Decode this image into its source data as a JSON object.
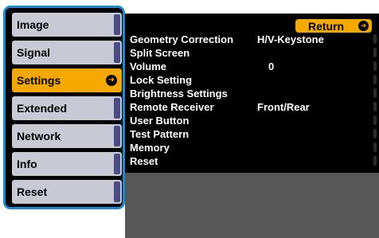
{
  "menu": {
    "items": [
      {
        "label": "Image",
        "selected": false
      },
      {
        "label": "Signal",
        "selected": false
      },
      {
        "label": "Settings",
        "selected": true
      },
      {
        "label": "Extended",
        "selected": false
      },
      {
        "label": "Network",
        "selected": false
      },
      {
        "label": "Info",
        "selected": false
      },
      {
        "label": "Reset",
        "selected": false
      }
    ],
    "enter_icon": "enter-icon"
  },
  "return_button": {
    "label": "Return",
    "icon": "enter-icon"
  },
  "settings": [
    {
      "name": "Geometry Correction",
      "value": "H/V-Keystone"
    },
    {
      "name": "Split Screen",
      "value": ""
    },
    {
      "name": "Volume",
      "value": "0"
    },
    {
      "name": "Lock Setting",
      "value": ""
    },
    {
      "name": "Brightness Settings",
      "value": ""
    },
    {
      "name": "Remote Receiver",
      "value": "Front/Rear"
    },
    {
      "name": "User Button",
      "value": ""
    },
    {
      "name": "Test Pattern",
      "value": ""
    },
    {
      "name": "Memory",
      "value": ""
    },
    {
      "name": "Reset",
      "value": ""
    }
  ],
  "colors": {
    "accent_orange": "#f5a800",
    "menu_gray": "#c9c9d6",
    "border_blue": "#1a8bd0",
    "panel_black": "#000000",
    "panel_gray": "#575757"
  }
}
